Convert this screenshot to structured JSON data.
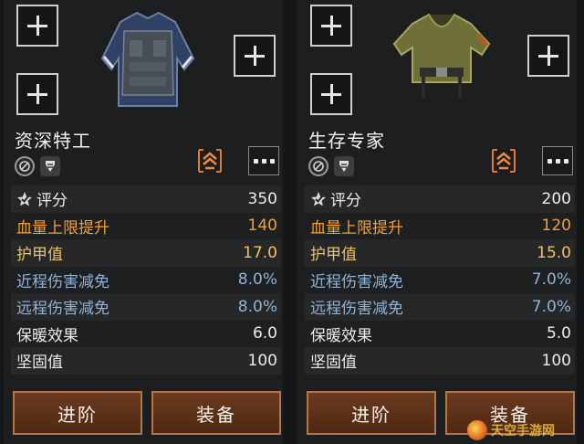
{
  "cards": [
    {
      "name": "资深特工",
      "stats": [
        {
          "label": "评分",
          "value": "350",
          "color": "white",
          "icon": "rating-star-icon"
        },
        {
          "label": "血量上限提升",
          "value": "140",
          "color": "orange"
        },
        {
          "label": "护甲值",
          "value": "17.0",
          "color": "yellow"
        },
        {
          "label": "近程伤害减免",
          "value": "8.0%",
          "color": "blue"
        },
        {
          "label": "远程伤害减免",
          "value": "8.0%",
          "color": "blue"
        },
        {
          "label": "保暖效果",
          "value": "6.0",
          "color": "white"
        },
        {
          "label": "坚固值",
          "value": "100",
          "color": "white"
        }
      ],
      "buttons": {
        "advance": "进阶",
        "equip": "装备"
      }
    },
    {
      "name": "生存专家",
      "stats": [
        {
          "label": "评分",
          "value": "200",
          "color": "white",
          "icon": "rating-star-icon"
        },
        {
          "label": "血量上限提升",
          "value": "120",
          "color": "orange"
        },
        {
          "label": "护甲值",
          "value": "15.0",
          "color": "yellow"
        },
        {
          "label": "近程伤害减免",
          "value": "7.0%",
          "color": "blue"
        },
        {
          "label": "远程伤害减免",
          "value": "7.0%",
          "color": "blue"
        },
        {
          "label": "保暖效果",
          "value": "5.0",
          "color": "white"
        },
        {
          "label": "坚固值",
          "value": "100",
          "color": "white"
        }
      ],
      "buttons": {
        "advance": "进阶",
        "equip": "装备"
      }
    }
  ],
  "watermark": "天空手游网"
}
